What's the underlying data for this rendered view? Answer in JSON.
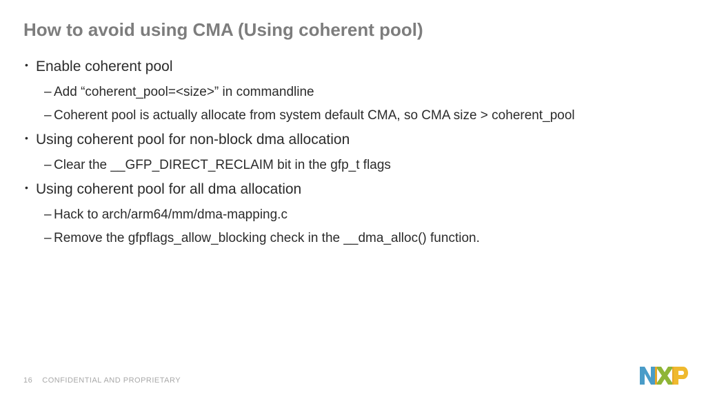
{
  "title": "How to avoid using CMA (Using coherent pool)",
  "bullets": {
    "b1": "Enable coherent pool",
    "b1_1": "Add “coherent_pool=<size>” in commandline",
    "b1_2": "Coherent pool is actually allocate from system default CMA, so CMA size > coherent_pool",
    "b2": "Using coherent pool for non-block dma allocation",
    "b2_1": "Clear the __GFP_DIRECT_RECLAIM bit in the gfp_t flags",
    "b3": "Using coherent pool for all dma allocation",
    "b3_1": "Hack to arch/arm64/mm/dma-mapping.c",
    "b3_2": "Remove the gfpflags_allow_blocking check in the __dma_alloc() function."
  },
  "footer": {
    "page": "16",
    "label": "CONFIDENTIAL AND PROPRIETARY"
  },
  "logo_name": "NXP"
}
